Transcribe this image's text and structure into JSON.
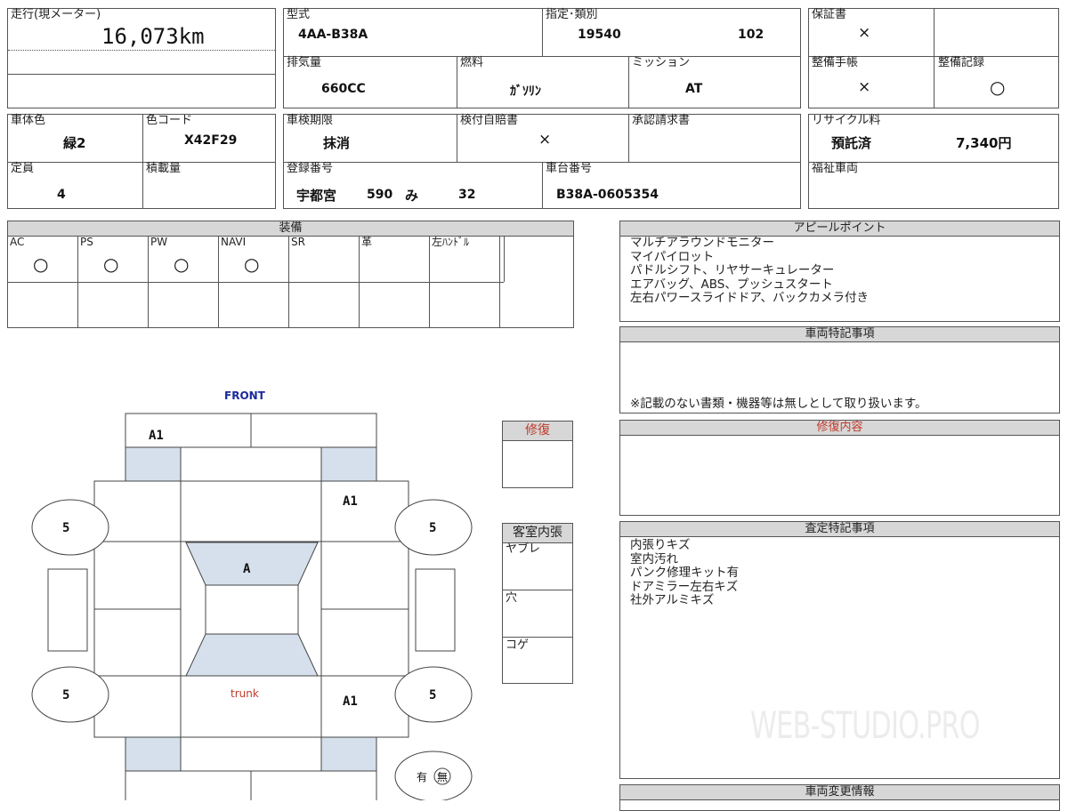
{
  "mileage": {
    "label": "走行(現メーター)",
    "value": "16,073km"
  },
  "model": {
    "label": "型式",
    "value": "4AA-B38A"
  },
  "designation": {
    "label": "指定･類別",
    "value1": "19540",
    "value2": "102"
  },
  "warranty": {
    "label": "保証書",
    "value": "×"
  },
  "displacement": {
    "label": "排気量",
    "value": "660CC"
  },
  "fuel": {
    "label": "燃料",
    "value": "ｶﾞｿﾘﾝ"
  },
  "mission": {
    "label": "ミッション",
    "value": "AT"
  },
  "maintenance_book": {
    "label": "整備手帳",
    "value": "×"
  },
  "maintenance_record": {
    "label": "整備記録",
    "value": "○"
  },
  "body_color": {
    "label": "車体色",
    "value": "緑2"
  },
  "color_code": {
    "label": "色コード",
    "value": "X42F29"
  },
  "inspection": {
    "label": "車検期限",
    "value": "抹消"
  },
  "insurance": {
    "label": "検付自賠書",
    "value": "×"
  },
  "approval": {
    "label": "承認請求書",
    "value": ""
  },
  "recycle": {
    "label": "リサイクル料",
    "status": "預託済",
    "amount": "7,340円"
  },
  "capacity": {
    "label": "定員",
    "value": "4"
  },
  "load": {
    "label": "積載量",
    "value": ""
  },
  "registration": {
    "label": "登録番号",
    "office": "宇都宮",
    "class": "590",
    "kana": "み",
    "number": "32"
  },
  "chassis": {
    "label": "車台番号",
    "value": "B38A-0605354"
  },
  "welfare": {
    "label": "福祉車両",
    "value": ""
  },
  "equipment": {
    "title": "装備",
    "items": [
      {
        "label": "AC",
        "mark": "○"
      },
      {
        "label": "PS",
        "mark": "○"
      },
      {
        "label": "PW",
        "mark": "○"
      },
      {
        "label": "NAVI",
        "mark": "○"
      },
      {
        "label": "SR",
        "mark": ""
      },
      {
        "label": "革",
        "mark": ""
      },
      {
        "label": "左ﾊﾝﾄﾞﾙ",
        "mark": ""
      }
    ]
  },
  "appeal": {
    "title": "アピールポイント",
    "lines": [
      "マルチアラウンドモニター",
      "マイパイロット",
      "パドルシフト、リヤサーキュレーター",
      "エアバッグ、ABS、プッシュスタート",
      "左右パワースライドドア、バックカメラ付き"
    ]
  },
  "vehicle_notes": {
    "title": "車両特記事項",
    "note": "※記載のない書類・機器等は無しとして取り扱います。"
  },
  "repair_content": {
    "title": "修復内容"
  },
  "assessment": {
    "title": "査定特記事項",
    "lines": [
      "内張りキズ",
      "室内汚れ",
      "パンク修理キット有",
      "ドアミラー左右キズ",
      "社外アルミキズ"
    ]
  },
  "vehicle_change": {
    "title": "車両変更情報"
  },
  "repair_box": {
    "title": "修復"
  },
  "interior": {
    "title": "客室内張",
    "items": [
      "ヤブレ",
      "穴",
      "コゲ"
    ]
  },
  "diagram": {
    "front": "FRONT",
    "trunk": "trunk",
    "marks": {
      "front_left": "A1",
      "right_front_door": "A1",
      "windshield": "A",
      "right_rear_door": "A1"
    },
    "tires": [
      "5",
      "5",
      "5",
      "5"
    ],
    "spare": {
      "yes": "有",
      "no": "無"
    }
  },
  "watermark": "WEB-STUDIO.PRO",
  "colors": {
    "panel_fill": "#d5e0ec",
    "header_fill": "#d7d7d7",
    "front_text": "#1a2a9a",
    "trunk_text": "#c0392b",
    "repair_title": "#c0392b"
  }
}
